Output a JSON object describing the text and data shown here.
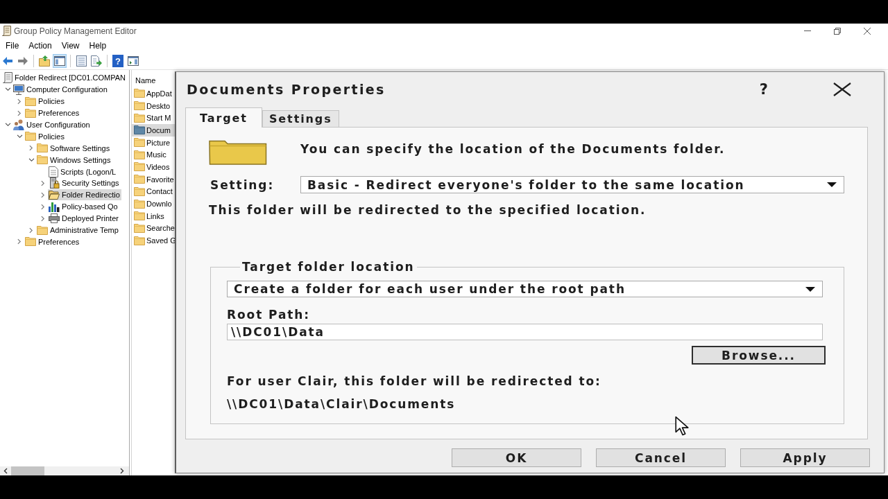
{
  "window": {
    "title": "Group Policy Management Editor"
  },
  "menu": [
    "File",
    "Action",
    "View",
    "Help"
  ],
  "toolbar": [
    {
      "kind": "back",
      "pressed": false,
      "disabled": false
    },
    {
      "kind": "forward",
      "pressed": false,
      "disabled": true
    },
    {
      "kind": "separator"
    },
    {
      "kind": "up",
      "pressed": false,
      "disabled": false
    },
    {
      "kind": "console-tree",
      "pressed": true,
      "disabled": false
    },
    {
      "kind": "separator"
    },
    {
      "kind": "properties",
      "pressed": false,
      "disabled": false
    },
    {
      "kind": "export",
      "pressed": false,
      "disabled": false
    },
    {
      "kind": "separator"
    },
    {
      "kind": "help",
      "label": "?",
      "pressed": false,
      "disabled": false
    },
    {
      "kind": "action-pane",
      "pressed": false,
      "disabled": false
    }
  ],
  "tree": {
    "label": "Folder Redirect [DC01.COMPAN",
    "kind": "gpo",
    "selected": false,
    "children": [
      {
        "label": "Computer Configuration",
        "kind": "computer",
        "expanded": true,
        "selected": false,
        "children": [
          {
            "label": "Policies",
            "kind": "folder",
            "expanded": false,
            "selected": false
          },
          {
            "label": "Preferences",
            "kind": "folder",
            "expanded": false,
            "selected": false
          }
        ]
      },
      {
        "label": "User Configuration",
        "kind": "user",
        "expanded": true,
        "selected": false,
        "children": [
          {
            "label": "Policies",
            "kind": "folder",
            "expanded": true,
            "selected": false,
            "children": [
              {
                "label": "Software Settings",
                "kind": "folder",
                "expanded": false,
                "selected": false
              },
              {
                "label": "Windows Settings",
                "kind": "folder",
                "expanded": true,
                "selected": false,
                "children": [
                  {
                    "label": "Scripts (Logon/L",
                    "kind": "script",
                    "selected": false
                  },
                  {
                    "label": "Security Settings",
                    "kind": "security",
                    "expanded": false,
                    "selected": false
                  },
                  {
                    "label": "Folder Redirectio",
                    "kind": "open-folder",
                    "expanded": false,
                    "selected": true
                  },
                  {
                    "label": "Policy-based Qo",
                    "kind": "chart",
                    "expanded": false,
                    "selected": false
                  },
                  {
                    "label": "Deployed Printer",
                    "kind": "printer",
                    "expanded": false,
                    "selected": false
                  }
                ]
              },
              {
                "label": "Administrative Temp",
                "kind": "folder",
                "expanded": false,
                "selected": false
              }
            ]
          },
          {
            "label": "Preferences",
            "kind": "folder",
            "expanded": false,
            "selected": false
          }
        ]
      }
    ]
  },
  "list": {
    "header": "Name",
    "items": [
      {
        "label": "AppDat",
        "kind": "folder",
        "selected": false
      },
      {
        "label": "Deskto",
        "kind": "folder",
        "selected": false
      },
      {
        "label": "Start M",
        "kind": "folder",
        "selected": false
      },
      {
        "label": "Docum",
        "kind": "redirected",
        "selected": true
      },
      {
        "label": "Picture",
        "kind": "folder",
        "selected": false
      },
      {
        "label": "Music",
        "kind": "folder",
        "selected": false
      },
      {
        "label": "Videos",
        "kind": "folder",
        "selected": false
      },
      {
        "label": "Favorite",
        "kind": "folder",
        "selected": false
      },
      {
        "label": "Contact",
        "kind": "folder",
        "selected": false
      },
      {
        "label": "Downlo",
        "kind": "folder",
        "selected": false
      },
      {
        "label": "Links",
        "kind": "folder",
        "selected": false
      },
      {
        "label": "Searche",
        "kind": "folder",
        "selected": false
      },
      {
        "label": "Saved G",
        "kind": "folder",
        "selected": false
      }
    ]
  },
  "dialog": {
    "title": "Documents Properties",
    "help": "?",
    "tabs": [
      {
        "label": "Target",
        "selected": true
      },
      {
        "label": "Settings",
        "selected": false
      }
    ],
    "intro": "You can specify the location of the Documents folder.",
    "setting": {
      "label": "Setting:",
      "value": "Basic - Redirect everyone's folder to the same location"
    },
    "description": "This folder will be redirected to the specified location.",
    "target_group": {
      "title": "Target folder location",
      "option": "Create a folder for each user under the root path",
      "root_path_label": "Root Path:",
      "root_path": "\\\\DC01\\Data",
      "browse": {
        "label": "Browse...",
        "focused": true
      },
      "preview_label": "For user Clair, this folder will be redirected to:",
      "preview_path": "\\\\DC01\\Data\\Clair\\Documents"
    },
    "buttons": [
      {
        "label": "OK"
      },
      {
        "label": "Cancel"
      },
      {
        "label": "Apply"
      }
    ]
  }
}
